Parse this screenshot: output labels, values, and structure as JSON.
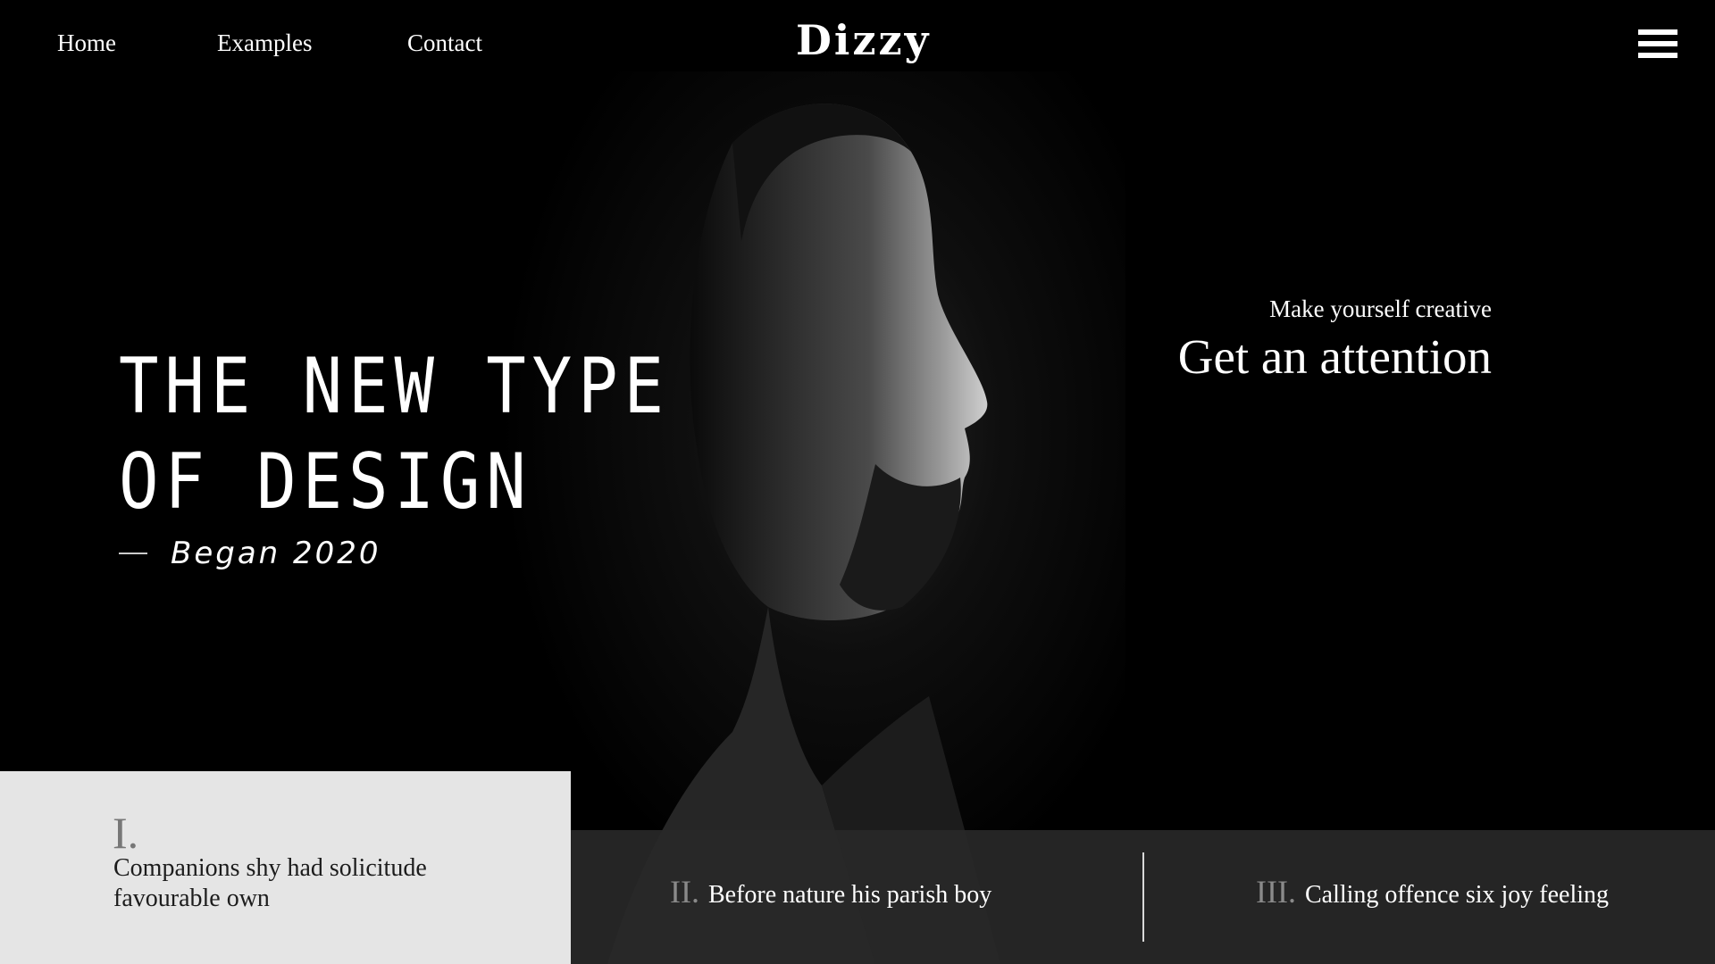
{
  "header": {
    "nav": [
      "Home",
      "Examples",
      "Contact"
    ],
    "brand": "Dizzy",
    "menu_icon": "hamburger-menu-icon"
  },
  "hero": {
    "title_line1": "THE NEW TYPE",
    "title_line2": "OF DESIGN",
    "subtitle": "Began 2020"
  },
  "tagline": {
    "small": "Make yourself creative",
    "big": "Get an attention"
  },
  "features": [
    {
      "num": "I.",
      "desc": "Companions shy had solicitude favourable own"
    },
    {
      "num": "II.",
      "desc": "Before nature his parish boy"
    },
    {
      "num": "III.",
      "desc": "Calling offence six joy feeling"
    }
  ],
  "colors": {
    "background": "#000000",
    "text": "#ffffff",
    "active_card": "#e5e5e5",
    "strip": "#282828",
    "numeral": "#8a8a8a"
  }
}
